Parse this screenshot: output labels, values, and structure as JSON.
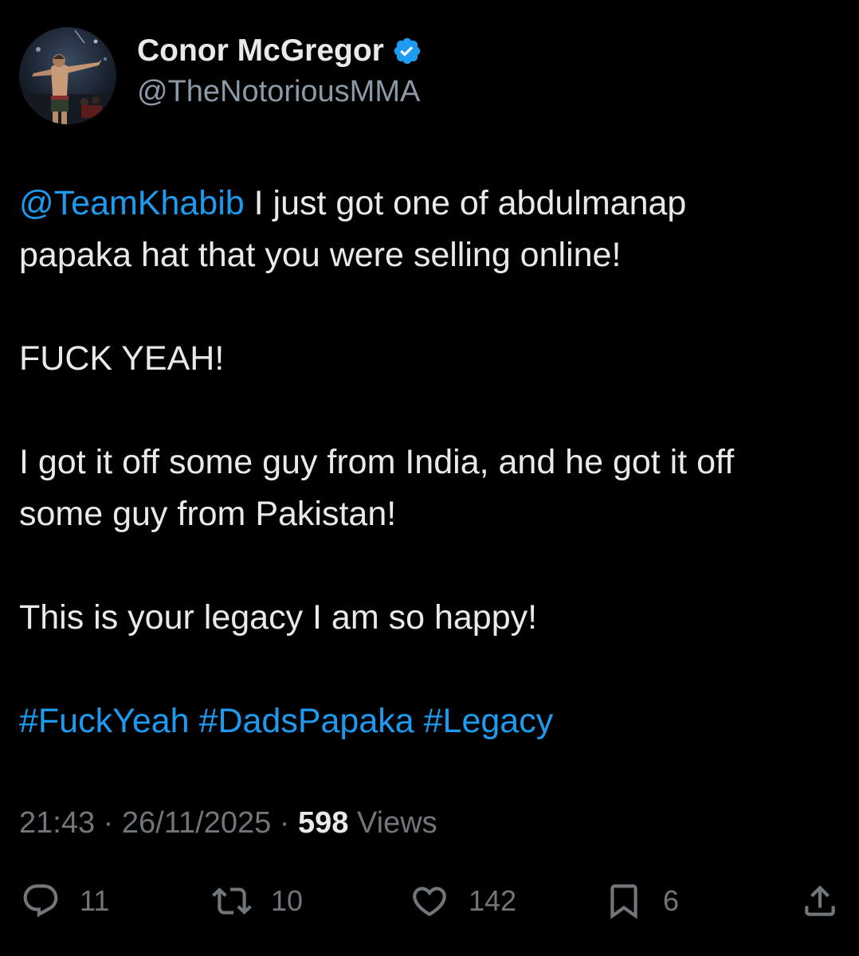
{
  "author": {
    "display_name": "Conor McGregor",
    "handle": "@TheNotoriousMMA",
    "verified": true,
    "avatar_icon": "avatar-photo",
    "verified_icon": "verified-badge-icon"
  },
  "tweet": {
    "mention": "@TeamKhabib",
    "line1_rest": " I just got one of abdulmanap",
    "line2": "papaka hat that you were selling online!",
    "line3": "FUCK YEAH!",
    "line4": "I got it off some guy from India, and he got it off",
    "line5": "some guy from Pakistan!",
    "line6": "This is your legacy I am so happy!",
    "hashtags": [
      "#FuckYeah",
      "#DadsPapaka",
      "#Legacy"
    ]
  },
  "meta": {
    "time": "21:43",
    "separator": " · ",
    "date": "26/11/2025",
    "views_count": "598",
    "views_label": " Views"
  },
  "actions": {
    "reply": {
      "icon": "reply-icon",
      "count": "11"
    },
    "repost": {
      "icon": "repost-icon",
      "count": "10"
    },
    "like": {
      "icon": "heart-icon",
      "count": "142"
    },
    "bookmark": {
      "icon": "bookmark-icon",
      "count": "6"
    },
    "share": {
      "icon": "share-icon"
    }
  },
  "colors": {
    "background": "#000000",
    "text": "#e7e9ea",
    "muted": "#71767b",
    "handle": "#8b98a5",
    "link": "#1d9bf0",
    "verified": "#1d9bf0"
  }
}
